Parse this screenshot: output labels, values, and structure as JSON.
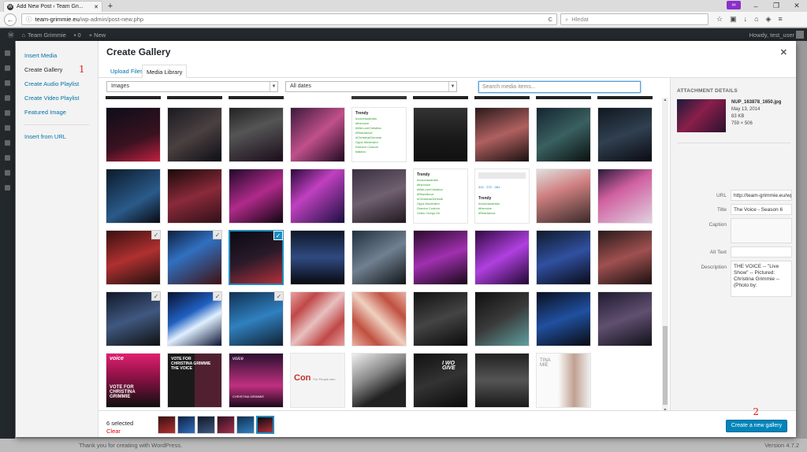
{
  "browser": {
    "tab_title": "Add New Post ‹ Team Gri...",
    "tab_close": "✕",
    "new_tab": "+",
    "url_host": "team-grimmie.eu",
    "url_path": "/wp-admin/post-new.php",
    "search_placeholder": "Hledat",
    "icons": [
      "star-icon",
      "clipboard-icon",
      "download-icon",
      "home-icon",
      "shield-icon",
      "menu-icon"
    ],
    "window_controls": [
      "–",
      "❐",
      "✕"
    ]
  },
  "adminbar": {
    "site": "Team Grimmie",
    "new": "+ New",
    "howdy": "Howdy, test_user"
  },
  "modal": {
    "title": "Create Gallery",
    "close": "✕",
    "menu": {
      "insert_media": "Insert Media",
      "create_gallery": "Create Gallery",
      "create_audio": "Create Audio Playlist",
      "create_video": "Create Video Playlist",
      "featured_image": "Featured Image",
      "insert_url": "Insert from URL"
    },
    "annotation_1": "1",
    "annotation_2": "2",
    "tabs": {
      "upload": "Upload Files",
      "library": "Media Library"
    },
    "filter_type": "Images",
    "filter_date": "All dates",
    "search_placeholder": "Search media items...",
    "thumb_text": {
      "trendy": "Trendy",
      "lines": [
        "#voiceaustralia",
        "#thevoice",
        "#WeLoveChristina",
        "#RiseAbove",
        "#ChristinaGrimmie",
        "Opps Moderator",
        "Director Custom",
        "Italiano",
        "Video Chego De"
      ]
    },
    "tile_text": {
      "voice": "voice",
      "vote_for": "VOTE FOR",
      "christina": "CHRISTINA GRIMMIE",
      "the_voice": "THE VOICE",
      "con": "Con",
      "for_people": "For People who",
      "i_wo": "I WO",
      "give": "GIVE",
      "tina": "TINA",
      "mie": "MIE"
    },
    "stats_nums": [
      "312",
      "272",
      "261"
    ]
  },
  "details": {
    "heading": "ATTACHMENT DETAILS",
    "filename": "NUP_163878_1650.jpg",
    "date": "May 13, 2014",
    "size": "83 KB",
    "dims": "759 × 506",
    "labels": {
      "url": "URL",
      "title": "Title",
      "caption": "Caption",
      "alt": "Alt Text",
      "description": "Description"
    },
    "url": "http://team-grimmie.eu/wp-",
    "title_value": "The Voice - Season 6",
    "caption_value": "",
    "alt_value": "",
    "description_value": "THE VOICE -- \"Live Show\" -- Pictured: Christina Grimmie -- (Photo by:"
  },
  "bottom": {
    "selected": "6 selected",
    "clear": "Clear",
    "create_button": "Create a new gallery"
  },
  "footer": {
    "thanks": "Thank you for creating with WordPress.",
    "version": "Version 4.7.2"
  },
  "colors": {
    "accent": "#0073aa",
    "selected": "#1e8cbe",
    "button": "#0085ba",
    "annotation": "#e02020"
  }
}
